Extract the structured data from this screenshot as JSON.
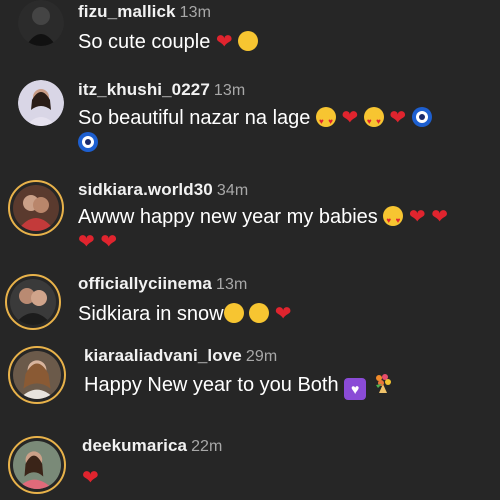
{
  "comments": [
    {
      "username": "fizu_mallick",
      "time": "13m",
      "text": "So cute couple",
      "emojis": [
        "heart",
        "smiling-face"
      ]
    },
    {
      "username": "itz_khushi_0227",
      "time": "13m",
      "text": "So beautiful nazar na lage",
      "emojis": [
        "heart-eyes",
        "heart",
        "heart-eyes",
        "heart",
        "evil-eye",
        "evil-eye"
      ]
    },
    {
      "username": "sidkiara.world30",
      "time": "34m",
      "text": "Awww happy new year my babies",
      "emojis": [
        "heart-eyes",
        "heart",
        "heart",
        "heart",
        "heart"
      ]
    },
    {
      "username": "officiallyciinema",
      "time": "13m",
      "text": "Sidkiara in snow",
      "emojis": [
        "pleading-face",
        "pleading-face",
        "heart"
      ]
    },
    {
      "username": "kiaraaliadvani_love",
      "time": "29m",
      "text": "Happy New year to you Both",
      "emojis": [
        "heart-decoration",
        "bouquet"
      ]
    },
    {
      "username": "deekumarica",
      "time": "22m",
      "text": "",
      "emojis": [
        "heart"
      ]
    }
  ],
  "colors": {
    "background": "#262626",
    "text": "#ffffff",
    "timestamp": "#a8a8a8",
    "heart": "#e0242e",
    "story_ring": "#e8b24a"
  }
}
